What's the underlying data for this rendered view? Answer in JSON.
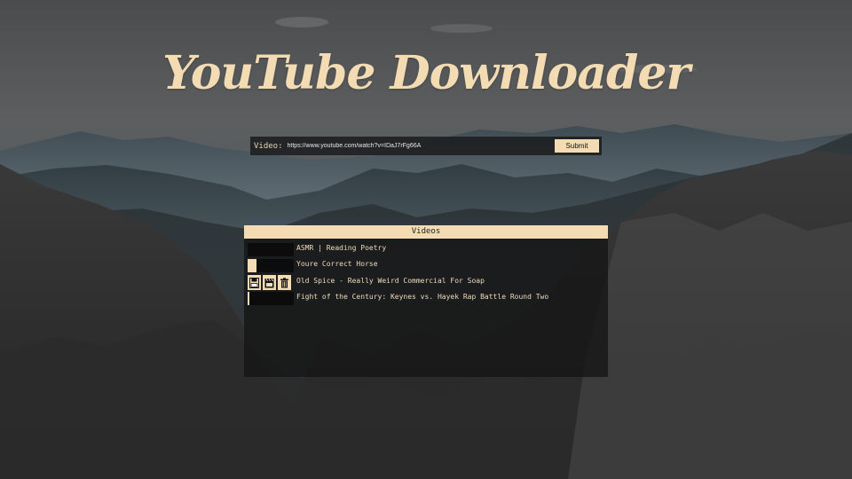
{
  "app": {
    "title": "YouTube Downloader"
  },
  "form": {
    "label": "Video:",
    "url_value": "https://www.youtube.com/watch?v=IDaJ7rFg66A",
    "submit_label": "Submit"
  },
  "panel": {
    "header": "Videos"
  },
  "videos": [
    {
      "title": "ASMR | Reading Poetry",
      "progress": 0
    },
    {
      "title": "Youre Correct Horse",
      "progress": 0.2
    },
    {
      "title": "Old Spice - Really Weird Commercial For Soap",
      "progress": 1,
      "actions": [
        "save-icon",
        "clapperboard-icon",
        "trash-icon"
      ]
    },
    {
      "title": "Fight of the Century: Keynes vs. Hayek Rap Battle Round Two",
      "progress": 0.03
    }
  ],
  "colors": {
    "accent": "#f3dcb3",
    "panel_bg": "#161616",
    "text": "#efdcbc"
  }
}
